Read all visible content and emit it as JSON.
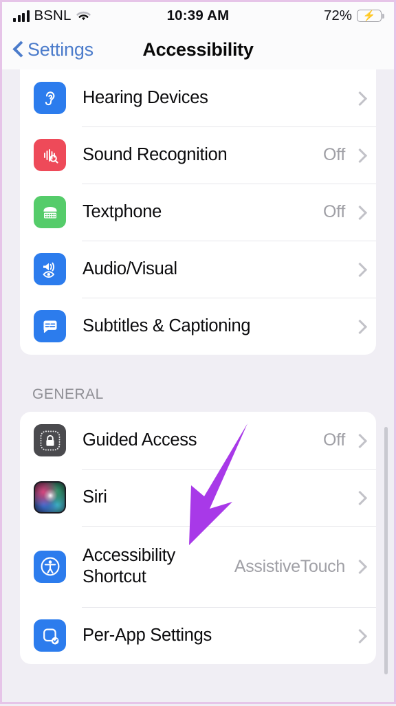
{
  "status_bar": {
    "carrier": "BSNL",
    "time": "10:39 AM",
    "battery_percent": "72%",
    "battery_level": 72,
    "signal_bars": 4,
    "wifi_icon": "wifi-icon",
    "charging_icon": "lightning-bolt-icon"
  },
  "nav": {
    "back_label": "Settings",
    "back_icon": "chevron-left-icon",
    "title": "Accessibility"
  },
  "sections": [
    {
      "header": "",
      "rows": [
        {
          "label": "Hearing Devices",
          "value": "",
          "icon": "ear-icon"
        },
        {
          "label": "Sound Recognition",
          "value": "Off",
          "icon": "sound-waveform-search-icon"
        },
        {
          "label": "Textphone",
          "value": "Off",
          "icon": "tty-telephone-icon"
        },
        {
          "label": "Audio/Visual",
          "value": "",
          "icon": "speaker-eye-icon"
        },
        {
          "label": "Subtitles & Captioning",
          "value": "",
          "icon": "speech-bubble-captions-icon"
        }
      ]
    },
    {
      "header": "GENERAL",
      "rows": [
        {
          "label": "Guided Access",
          "value": "Off",
          "icon": "padlock-dotted-icon"
        },
        {
          "label": "Siri",
          "value": "",
          "icon": "siri-orb-icon"
        },
        {
          "label": "Accessibility Shortcut",
          "value": "AssistiveTouch",
          "icon": "accessibility-person-icon"
        },
        {
          "label": "Per-App Settings",
          "value": "",
          "icon": "app-checkmark-icon"
        }
      ]
    }
  ],
  "annotation": {
    "arrow_color": "#a839e8",
    "points_at": "Accessibility Shortcut"
  },
  "colors": {
    "accent_blue": "#4c7ccb",
    "icon_blue": "#2c7ced",
    "icon_red": "#ee4a59",
    "icon_green": "#55cc6a",
    "icon_dark": "#4a4a4e",
    "page_background": "#f0eef4",
    "card_background": "#ffffff",
    "secondary_text": "#a0a0a6",
    "frame_border": "#e6c4e8"
  }
}
